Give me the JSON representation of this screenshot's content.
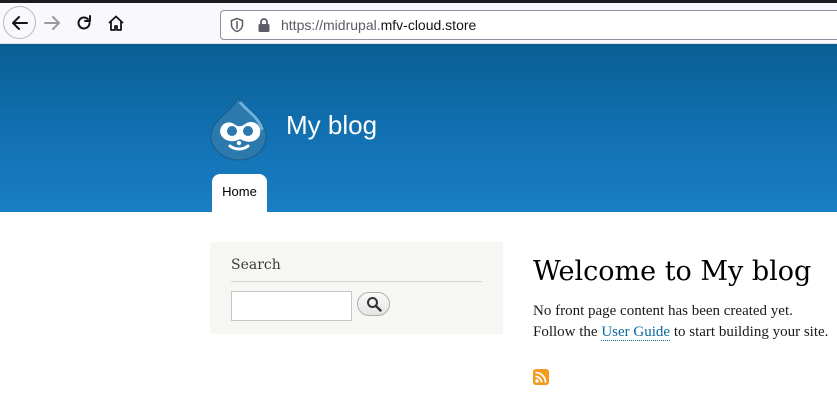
{
  "browser": {
    "url_prefix": "https://midrupal.",
    "url_host": "mfv-cloud.store"
  },
  "site": {
    "name": "My blog",
    "nav": [
      {
        "label": "Home"
      }
    ]
  },
  "sidebar": {
    "search_title": "Search",
    "search_value": ""
  },
  "main": {
    "title": "Welcome to My blog",
    "line1": "No front page content has been created yet.",
    "line2_before": "Follow the ",
    "line2_link": "User Guide",
    "line2_after": " to start building your site."
  },
  "icons": {
    "back": "back-arrow-icon",
    "forward": "forward-arrow-icon",
    "reload": "reload-icon",
    "home": "home-icon",
    "shield": "shield-icon",
    "lock": "lock-icon",
    "logo": "drupal-drop-logo",
    "search": "magnifier-icon",
    "rss": "rss-feed-icon"
  },
  "colors": {
    "header_top": "#0a5e93",
    "header_bottom": "#1a7fc3",
    "link": "#0b6aa0",
    "rss": "#f39a1e"
  }
}
